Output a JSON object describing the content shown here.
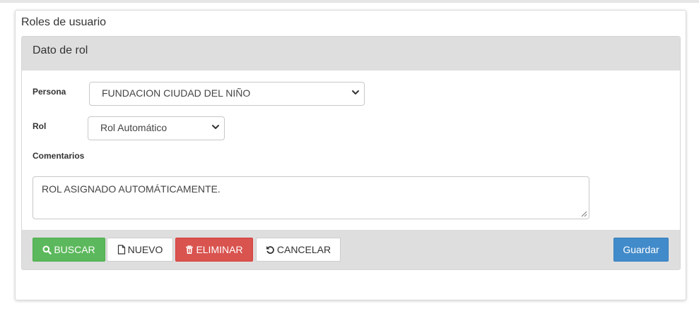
{
  "page": {
    "title": "Roles de usuario"
  },
  "panel": {
    "title": "Dato de rol"
  },
  "form": {
    "persona": {
      "label": "Persona",
      "value": "FUNDACION CIUDAD DEL NIÑO"
    },
    "rol": {
      "label": "Rol",
      "value": "Rol Automático"
    },
    "comentarios": {
      "label": "Comentarios",
      "value": "ROL ASIGNADO AUTOMÁTICAMENTE."
    }
  },
  "buttons": {
    "buscar": {
      "label": "BUSCAR",
      "icon": "search-icon",
      "color": "#5cb85c"
    },
    "nuevo": {
      "label": "NUEVO",
      "icon": "file-icon",
      "color": "#ffffff"
    },
    "eliminar": {
      "label": "ELIMINAR",
      "icon": "trash-icon",
      "color": "#d9534f"
    },
    "cancelar": {
      "label": "CANCELAR",
      "icon": "undo-icon",
      "color": "#ffffff"
    },
    "guardar": {
      "label": "Guardar",
      "color": "#428bca"
    }
  }
}
